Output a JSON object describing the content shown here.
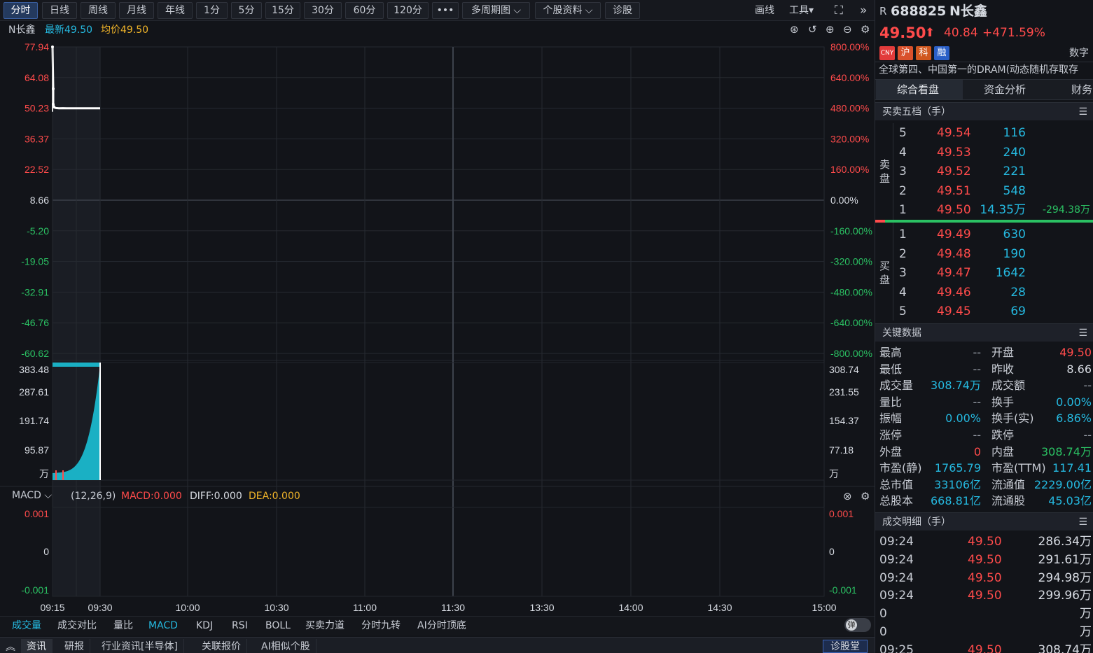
{
  "toolbar": {
    "periods": [
      "分时",
      "日线",
      "周线",
      "月线",
      "年线",
      "1分",
      "5分",
      "15分",
      "30分",
      "60分",
      "120分",
      "•••",
      "多周期图 ⌵",
      "个股资料 ⌵",
      "诊股"
    ],
    "draw": "画线",
    "tools": "工具▾",
    "fullscreen_icon": "⛶",
    "more_icon": "»"
  },
  "chart_header": {
    "name": "N长鑫",
    "latest": "最新49.50",
    "avg": "均价49.50",
    "icons": [
      "target-icon",
      "undo-icon",
      "zoom-in-icon",
      "zoom-out-icon",
      "gear-icon"
    ]
  },
  "price_axis": {
    "left": [
      "77.94",
      "64.08",
      "50.23",
      "36.37",
      "22.52",
      "8.66",
      "-5.20",
      "-19.05",
      "-32.91",
      "-46.76",
      "-60.62"
    ],
    "right": [
      "800.00%",
      "640.00%",
      "480.00%",
      "320.00%",
      "160.00%",
      "0.00%",
      "-160.00%",
      "-320.00%",
      "-480.00%",
      "-640.00%",
      "-800.00%"
    ]
  },
  "volume_axis": {
    "left": [
      "383.48",
      "287.61",
      "191.74",
      "95.87",
      "万"
    ],
    "right": [
      "308.74",
      "231.55",
      "154.37",
      "77.18",
      "万"
    ]
  },
  "macd": {
    "selector": "MACD",
    "params": "(12,26,9)",
    "macd": "MACD:0.000",
    "diff": "DIFF:0.000",
    "dea": "DEA:0.000",
    "left": [
      "0.001",
      "0",
      "-0.001"
    ],
    "right": [
      "0.001",
      "0",
      "-0.001"
    ]
  },
  "time_axis": [
    "09:15",
    "09:30",
    "10:00",
    "10:30",
    "11:00",
    "11:30",
    "13:30",
    "14:00",
    "14:30",
    "15:00"
  ],
  "chart_data": {
    "type": "line",
    "title": "",
    "xlabel": "",
    "ylabel": "",
    "ylim": [
      -60.62,
      77.94
    ],
    "x": [
      "09:15",
      "09:16",
      "09:17",
      "09:18",
      "09:19",
      "09:20",
      "09:21",
      "09:22",
      "09:23",
      "09:24",
      "09:25",
      "09:26",
      "09:27",
      "09:28",
      "09:29",
      "09:30"
    ],
    "series": [
      {
        "values": [
          77.94,
          59.0,
          52.0,
          50.8,
          50.5,
          50.3,
          50.2,
          50.23,
          50.2,
          50.2,
          50.2,
          50.2,
          50.2,
          50.2,
          50.2,
          50.2
        ]
      }
    ],
    "volume_max": 383.48,
    "volume_unit": "万"
  },
  "indicator_tabs": [
    "成交量",
    "成交对比",
    "量比",
    "MACD",
    "KDJ",
    "RSI",
    "BOLL",
    "买卖力道",
    "分时九转",
    "AI分时顶底"
  ],
  "bottom_tabs": [
    "资讯",
    "研报",
    "行业资讯[半导体]",
    "关联报价",
    "AI相似个股"
  ],
  "bottom_right": "诊股堂",
  "toggle_label": "弹",
  "quote": {
    "prefix": "R",
    "code": "688825",
    "name": "N长鑫",
    "price": "49.50",
    "arrow": "⬆",
    "change": "40.84",
    "pct": "+471.59%",
    "badges": [
      "CNY",
      "沪",
      "科",
      "融"
    ],
    "digital": "数字",
    "desc": "全球第四、中国第一的DRAM(动态随机存取存",
    "tabs": [
      "综合看盘",
      "资金分析",
      "财务"
    ]
  },
  "orderbook": {
    "title": "买卖五档（手）",
    "sell_label": [
      "卖",
      "盘"
    ],
    "buy_label": [
      "买",
      "盘"
    ],
    "sell": [
      {
        "lvl": "5",
        "price": "49.54",
        "vol": "116",
        "extra": ""
      },
      {
        "lvl": "4",
        "price": "49.53",
        "vol": "240",
        "extra": ""
      },
      {
        "lvl": "3",
        "price": "49.52",
        "vol": "221",
        "extra": ""
      },
      {
        "lvl": "2",
        "price": "49.51",
        "vol": "548",
        "extra": ""
      },
      {
        "lvl": "1",
        "price": "49.50",
        "vol": "14.35万",
        "extra": "-294.38万"
      }
    ],
    "buy": [
      {
        "lvl": "1",
        "price": "49.49",
        "vol": "630"
      },
      {
        "lvl": "2",
        "price": "49.48",
        "vol": "190"
      },
      {
        "lvl": "3",
        "price": "49.47",
        "vol": "1642"
      },
      {
        "lvl": "4",
        "price": "49.46",
        "vol": "28"
      },
      {
        "lvl": "5",
        "price": "49.45",
        "vol": "69"
      }
    ]
  },
  "keydata": {
    "title": "关键数据",
    "rows": [
      [
        {
          "k": "最高",
          "v": "--",
          "c": "gray"
        },
        {
          "k": "开盘",
          "v": "49.50",
          "c": "red"
        }
      ],
      [
        {
          "k": "最低",
          "v": "--",
          "c": "gray"
        },
        {
          "k": "昨收",
          "v": "8.66",
          "c": "white"
        }
      ],
      [
        {
          "k": "成交量",
          "v": "308.74万",
          "c": "cyan"
        },
        {
          "k": "成交额",
          "v": "--",
          "c": "gray"
        }
      ],
      [
        {
          "k": "量比",
          "v": "--",
          "c": "gray"
        },
        {
          "k": "换手",
          "v": "0.00%",
          "c": "cyan"
        }
      ],
      [
        {
          "k": "振幅",
          "v": "0.00%",
          "c": "cyan"
        },
        {
          "k": "换手(实)",
          "v": "6.86%",
          "c": "cyan"
        }
      ],
      [
        {
          "k": "涨停",
          "v": "--",
          "c": "gray"
        },
        {
          "k": "跌停",
          "v": "--",
          "c": "gray"
        }
      ],
      [
        {
          "k": "外盘",
          "v": "0",
          "c": "red"
        },
        {
          "k": "内盘",
          "v": "308.74万",
          "c": "green"
        }
      ],
      [
        {
          "k": "市盈(静)",
          "v": "1765.79",
          "c": "cyan"
        },
        {
          "k": "市盈(TTM)",
          "v": "117.41",
          "c": "cyan"
        }
      ],
      [
        {
          "k": "总市值",
          "v": "33106亿",
          "c": "cyan"
        },
        {
          "k": "流通值",
          "v": "2229.00亿",
          "c": "cyan"
        }
      ],
      [
        {
          "k": "总股本",
          "v": "668.81亿",
          "c": "cyan"
        },
        {
          "k": "流通股",
          "v": "45.03亿",
          "c": "cyan"
        }
      ]
    ]
  },
  "trades": {
    "title": "成交明细（手）",
    "rows": [
      {
        "t": "09:24",
        "p": "49.50",
        "v": "286.34万"
      },
      {
        "t": "09:24",
        "p": "49.50",
        "v": "291.61万"
      },
      {
        "t": "09:24",
        "p": "49.50",
        "v": "294.98万"
      },
      {
        "t": "09:24",
        "p": "49.50",
        "v": "299.96万"
      },
      {
        "t": "0",
        "p": "",
        "v": "万"
      },
      {
        "t": "0",
        "p": "",
        "v": "万"
      },
      {
        "t": "09:25",
        "p": "49.50",
        "v": "308.74万"
      }
    ]
  },
  "colors": {
    "up": "#ff4b4b",
    "down": "#2bc163",
    "volume": "#1ab0c4",
    "accent": "#25b9e0",
    "avg": "#f0b429"
  }
}
